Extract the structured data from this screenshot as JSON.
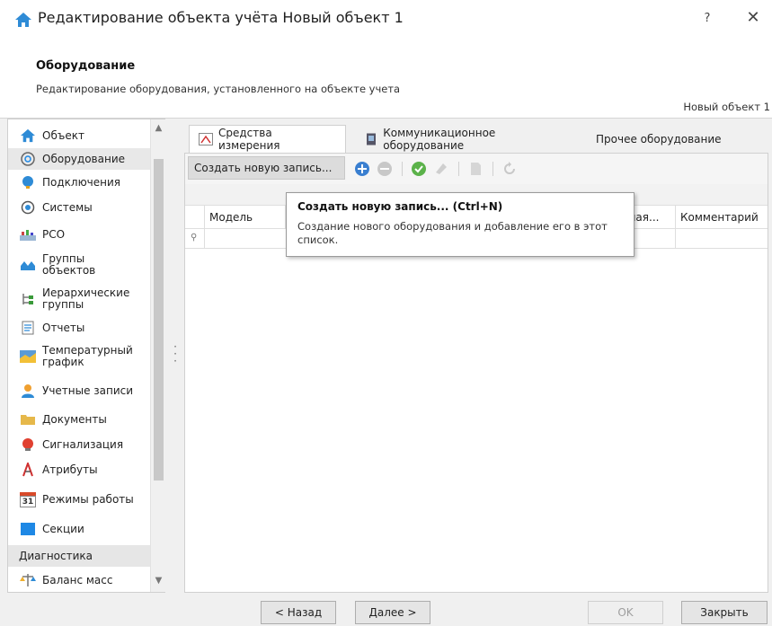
{
  "window": {
    "title": "Редактирование объекта учёта Новый объект 1",
    "help": "?",
    "close": "✕"
  },
  "header": {
    "title": "Оборудование",
    "subtitle": "Редактирование оборудования, установленного на объекте учета",
    "object_name": "Новый объект 1"
  },
  "sidebar": {
    "items": [
      {
        "label": "Объект",
        "icon": "house-icon"
      },
      {
        "label": "Оборудование",
        "icon": "equipment-icon",
        "selected": true
      },
      {
        "label": "Подключения",
        "icon": "connection-icon"
      },
      {
        "label": "Системы",
        "icon": "systems-icon"
      },
      {
        "label": "PCO",
        "icon": "pco-icon"
      },
      {
        "label": "Группы объектов",
        "icon": "object-groups-icon"
      },
      {
        "label": "Иерархические группы",
        "icon": "hierarchy-icon"
      },
      {
        "label": "Отчеты",
        "icon": "report-icon"
      },
      {
        "label": "Температурный график",
        "icon": "temperature-chart-icon"
      },
      {
        "label": "Учетные записи",
        "icon": "user-icon"
      },
      {
        "label": "Документы",
        "icon": "folder-icon"
      },
      {
        "label": "Сигнализация",
        "icon": "alarm-icon"
      },
      {
        "label": "Атрибуты",
        "icon": "attributes-icon"
      },
      {
        "label": "Режимы работы",
        "icon": "calendar-icon",
        "icon_text": "31"
      },
      {
        "label": "Секции",
        "icon": "sections-icon"
      }
    ],
    "group_label": "Диагностика",
    "extra_items": [
      {
        "label": "Баланс масс",
        "icon": "balance-icon"
      }
    ]
  },
  "tabs": [
    {
      "label": "Средства измерения",
      "icon": "measuring-icon",
      "active": true
    },
    {
      "label": "Коммуникационное оборудование",
      "icon": "device-icon"
    },
    {
      "label": "Прочее оборудование"
    }
  ],
  "toolbar": {
    "create_label": "Создать новую запись..."
  },
  "grid": {
    "columns": [
      "Модель",
      "емая...",
      "Комментарий"
    ]
  },
  "tooltip": {
    "title": "Создать новую запись... (Ctrl+N)",
    "body": "Создание нового оборудования и добавление его в этот список."
  },
  "footer": {
    "back": "< Назад",
    "next": "Далее >",
    "ok": "OK",
    "close": "Закрыть"
  },
  "colors": {
    "accent": "#1e88e5",
    "selected_bg": "#e8e8e8"
  }
}
